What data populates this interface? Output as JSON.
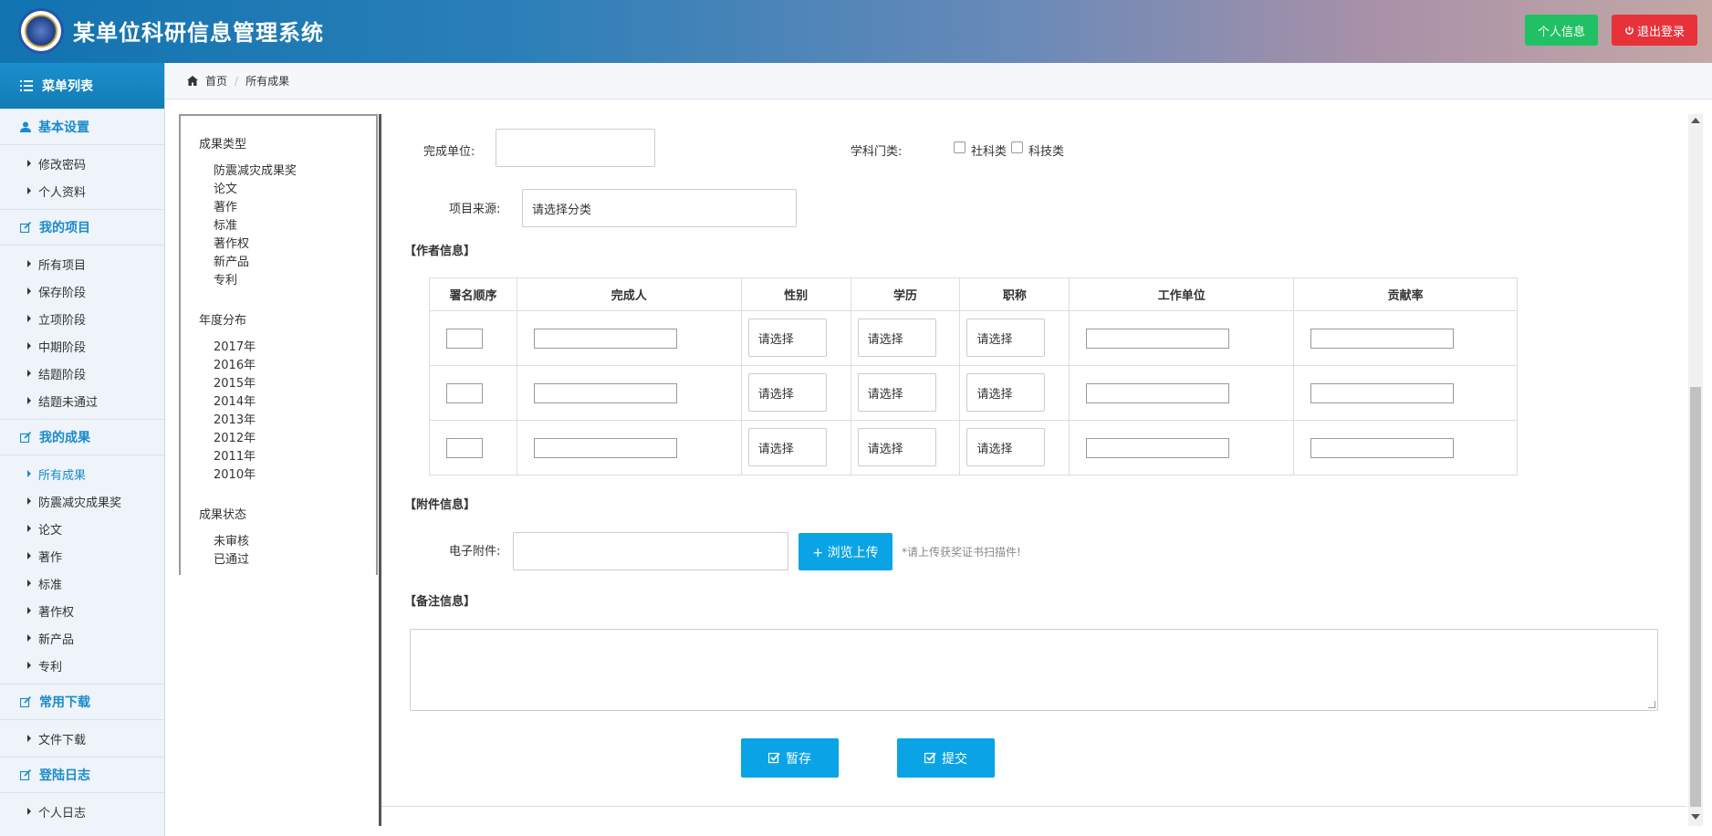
{
  "header": {
    "title": "某单位科研信息管理系统",
    "profile_button": "个人信息",
    "logout_button": "退出登录"
  },
  "sidebar": {
    "menu_title": "菜单列表",
    "groups": [
      {
        "title": "基本设置",
        "items": [
          "修改密码",
          "个人资料"
        ]
      },
      {
        "title": "我的项目",
        "items": [
          "所有项目",
          "保存阶段",
          "立项阶段",
          "中期阶段",
          "结题阶段",
          "结题未通过"
        ]
      },
      {
        "title": "我的成果",
        "items": [
          "所有成果",
          "防震减灾成果奖",
          "论文",
          "著作",
          "标准",
          "著作权",
          "新产品",
          "专利"
        ]
      },
      {
        "title": "常用下载",
        "items": [
          "文件下载"
        ]
      },
      {
        "title": "登陆日志",
        "items": [
          "个人日志"
        ]
      }
    ]
  },
  "breadcrumb": {
    "home": "首页",
    "current": "所有成果"
  },
  "filter": {
    "type_title": "成果类型",
    "types": [
      "防震减灾成果奖",
      "论文",
      "著作",
      "标准",
      "著作权",
      "新产品",
      "专利"
    ],
    "year_title": "年度分布",
    "years": [
      "2017年",
      "2016年",
      "2015年",
      "2014年",
      "2013年",
      "2012年",
      "2011年",
      "2010年"
    ],
    "status_title": "成果状态",
    "statuses": [
      "未审核",
      "已通过"
    ]
  },
  "form": {
    "unit_label": "完成单位:",
    "unit_value": "",
    "discipline_label": "学科门类:",
    "discipline_options": [
      "社科类",
      "科技类"
    ],
    "source_label": "项目来源:",
    "source_value": "请选择分类",
    "authors_section": "【作者信息】",
    "columns": [
      "署名顺序",
      "完成人",
      "性别",
      "学历",
      "职称",
      "工作单位",
      "贡献率"
    ],
    "select_placeholder": "请选择",
    "attachments_section": "【附件信息】",
    "attachment_label": "电子附件:",
    "upload_button": "+ 浏览上传",
    "upload_hint": "*请上传获奖证书扫描件!",
    "notes_section": "【备注信息】",
    "save_button": "暂存",
    "submit_button": "提交"
  },
  "colors": {
    "accent": "#0aa3e6",
    "green": "#22c064",
    "red": "#e8323a",
    "sidebar_link": "#1b8bcb"
  }
}
